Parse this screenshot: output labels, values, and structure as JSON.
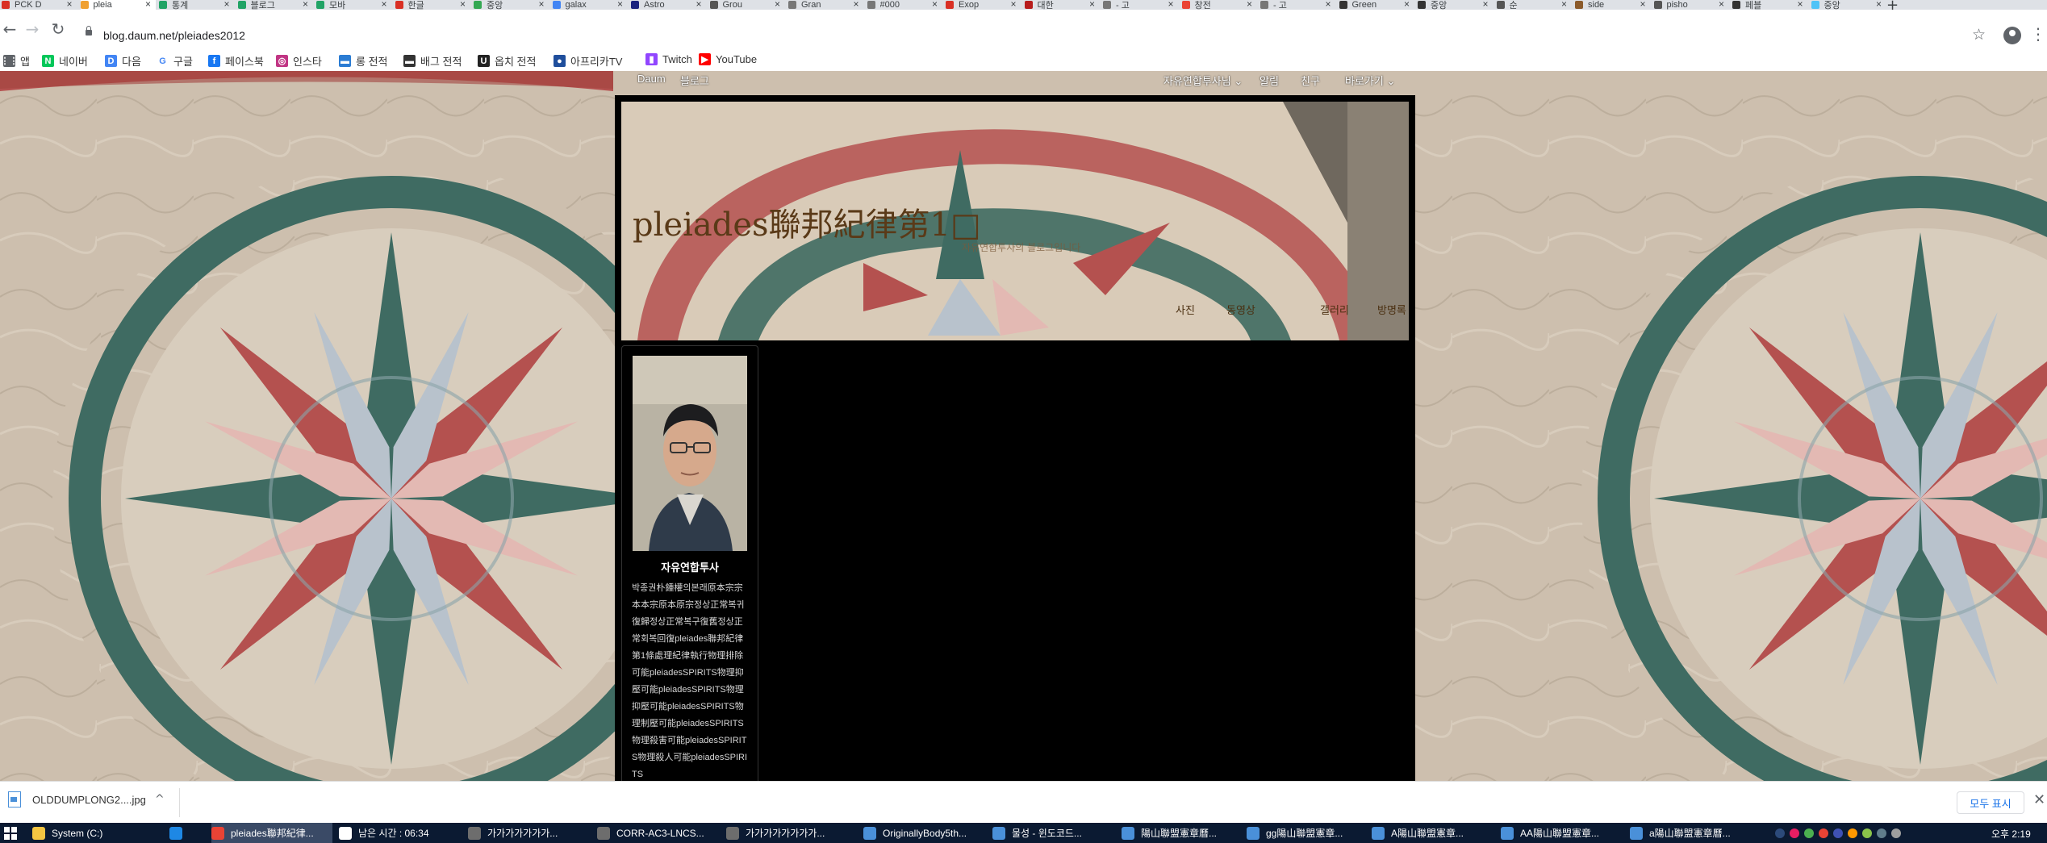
{
  "browser": {
    "tabs": [
      {
        "title": "PCK D",
        "fav": "#d93025"
      },
      {
        "title": "pleia",
        "fav": "#f0a030",
        "active": true
      },
      {
        "title": "통계",
        "fav": "#21a366"
      },
      {
        "title": "블로그",
        "fav": "#21a366"
      },
      {
        "title": "모바",
        "fav": "#21a366"
      },
      {
        "title": "한글",
        "fav": "#d93025"
      },
      {
        "title": "중앙",
        "fav": "#34a853"
      },
      {
        "title": "galax",
        "fav": "#4285f4"
      },
      {
        "title": "Astro",
        "fav": "#1a237e"
      },
      {
        "title": "Grou",
        "fav": "#555555"
      },
      {
        "title": "Gran",
        "fav": "#777777"
      },
      {
        "title": "#000",
        "fav": "#777777"
      },
      {
        "title": "Exop",
        "fav": "#d93025"
      },
      {
        "title": "대한",
        "fav": "#b71c1c"
      },
      {
        "title": "- 고",
        "fav": "#777777"
      },
      {
        "title": "창전",
        "fav": "#ea4335"
      },
      {
        "title": "- 고",
        "fav": "#777777"
      },
      {
        "title": "Green",
        "fav": "#333333"
      },
      {
        "title": "중앙",
        "fav": "#333333"
      },
      {
        "title": "순",
        "fav": "#555555"
      },
      {
        "title": "side",
        "fav": "#8b5a2b"
      },
      {
        "title": "pisho",
        "fav": "#555555"
      },
      {
        "title": "페블",
        "fav": "#333333"
      },
      {
        "title": "중앙",
        "fav": "#4fc3f7"
      }
    ],
    "new_tab": "+",
    "back_icon": "←",
    "forward_icon": "→",
    "reload_icon": "↻",
    "url": "blog.daum.net/pleiades2012",
    "star_icon": "☆",
    "menu_icon": "⋮"
  },
  "bookmarks": [
    {
      "label": "앱",
      "icon": "apps-icon",
      "color": "#5f6368",
      "glyph": "⋮⋮"
    },
    {
      "label": "네이버",
      "icon": "naver-icon",
      "color": "#03c75a",
      "glyph": "N"
    },
    {
      "label": "다음",
      "icon": "daum-icon",
      "color": "#4285f4",
      "glyph": "D"
    },
    {
      "label": "구글",
      "icon": "google-icon",
      "color": "#ffffff",
      "glyph": "G"
    },
    {
      "label": "페이스북",
      "icon": "facebook-icon",
      "color": "#1877f2",
      "glyph": "f"
    },
    {
      "label": "인스타",
      "icon": "instagram-icon",
      "color": "#c13584",
      "glyph": "◎"
    },
    {
      "label": "롱 전적",
      "icon": "lol-icon",
      "color": "#2b7cd3",
      "glyph": "▬"
    },
    {
      "label": "배그 전적",
      "icon": "pubg-icon",
      "color": "#333333",
      "glyph": "▬"
    },
    {
      "label": "옵치 전적",
      "icon": "overwatch-icon",
      "color": "#222222",
      "glyph": "U"
    },
    {
      "label": "아프리카TV",
      "icon": "afreecatv-icon",
      "color": "#1f4e9c",
      "glyph": "●"
    },
    {
      "label": "Twitch",
      "icon": "twitch-icon",
      "color": "#9146ff",
      "glyph": "▮"
    },
    {
      "label": "YouTube",
      "icon": "youtube-icon",
      "color": "#ff0000",
      "glyph": "▶"
    }
  ],
  "site": {
    "top_links": {
      "daum": "Daum",
      "blog": "블로그"
    },
    "top_right": {
      "user": "자유연합투사님 ⌄",
      "alarm": "알림",
      "friend": "친구",
      "shortcut": "바로가기 ⌄"
    },
    "blog_title": "pleiades聯邦紀律第1□",
    "blog_desc": "자유연합투사의 블로그입니다",
    "menu": [
      "사진",
      "동영상",
      "갤러리",
      "방명록"
    ]
  },
  "profile": {
    "nickname": "자유연합투사",
    "intro": "박종권朴鍾權의본래原本宗宗本本宗原本原宗정상正常복귀復歸정상正常복구復舊정상正常회복回復pleiades聯邦紀律第1條處理紀律執行物理排除可能pleiadesSPIRITS物理抑壓可能pleiadesSPIRITS物理抑壓可能pleiadesSPIRITS物理制壓可能pleiadesSPIRITS物理殺害可能pleiadesSPIRITS物理殺人可能pleiadesSPIRITS"
  },
  "download": {
    "filename": "OLDDUMPLONG2....jpg",
    "chevron": "^",
    "show_all": "모두 표시",
    "close": "✕"
  },
  "taskbar": {
    "items": [
      {
        "label": "System (C:)",
        "color": "#f4c542"
      },
      {
        "label": "",
        "color": "#1e88e5"
      },
      {
        "label": "pleiades聯邦紀律...",
        "color": "#ea4335",
        "active": true
      },
      {
        "label": "남은 시간 : 06:34",
        "color": "#ffffff"
      },
      {
        "label": "가가가가가가가...",
        "color": "#6d6d6d"
      },
      {
        "label": "CORR-AC3-LNCS...",
        "color": "#6d6d6d"
      },
      {
        "label": "가가가가가가가가...",
        "color": "#6d6d6d"
      },
      {
        "label": "OriginallyBody5th...",
        "color": "#4a90d9"
      },
      {
        "label": "물성 - 윈도코드...",
        "color": "#4a90d9"
      },
      {
        "label": "陽山聯盟憲章曆...",
        "color": "#4a90d9"
      },
      {
        "label": "gg陽山聯盟憲章...",
        "color": "#4a90d9"
      },
      {
        "label": "A陽山聯盟憲章...",
        "color": "#4a90d9"
      },
      {
        "label": "AA陽山聯盟憲章...",
        "color": "#4a90d9"
      },
      {
        "label": "a陽山聯盟憲章曆...",
        "color": "#4a90d9"
      }
    ],
    "clock": "오후 2:19"
  }
}
